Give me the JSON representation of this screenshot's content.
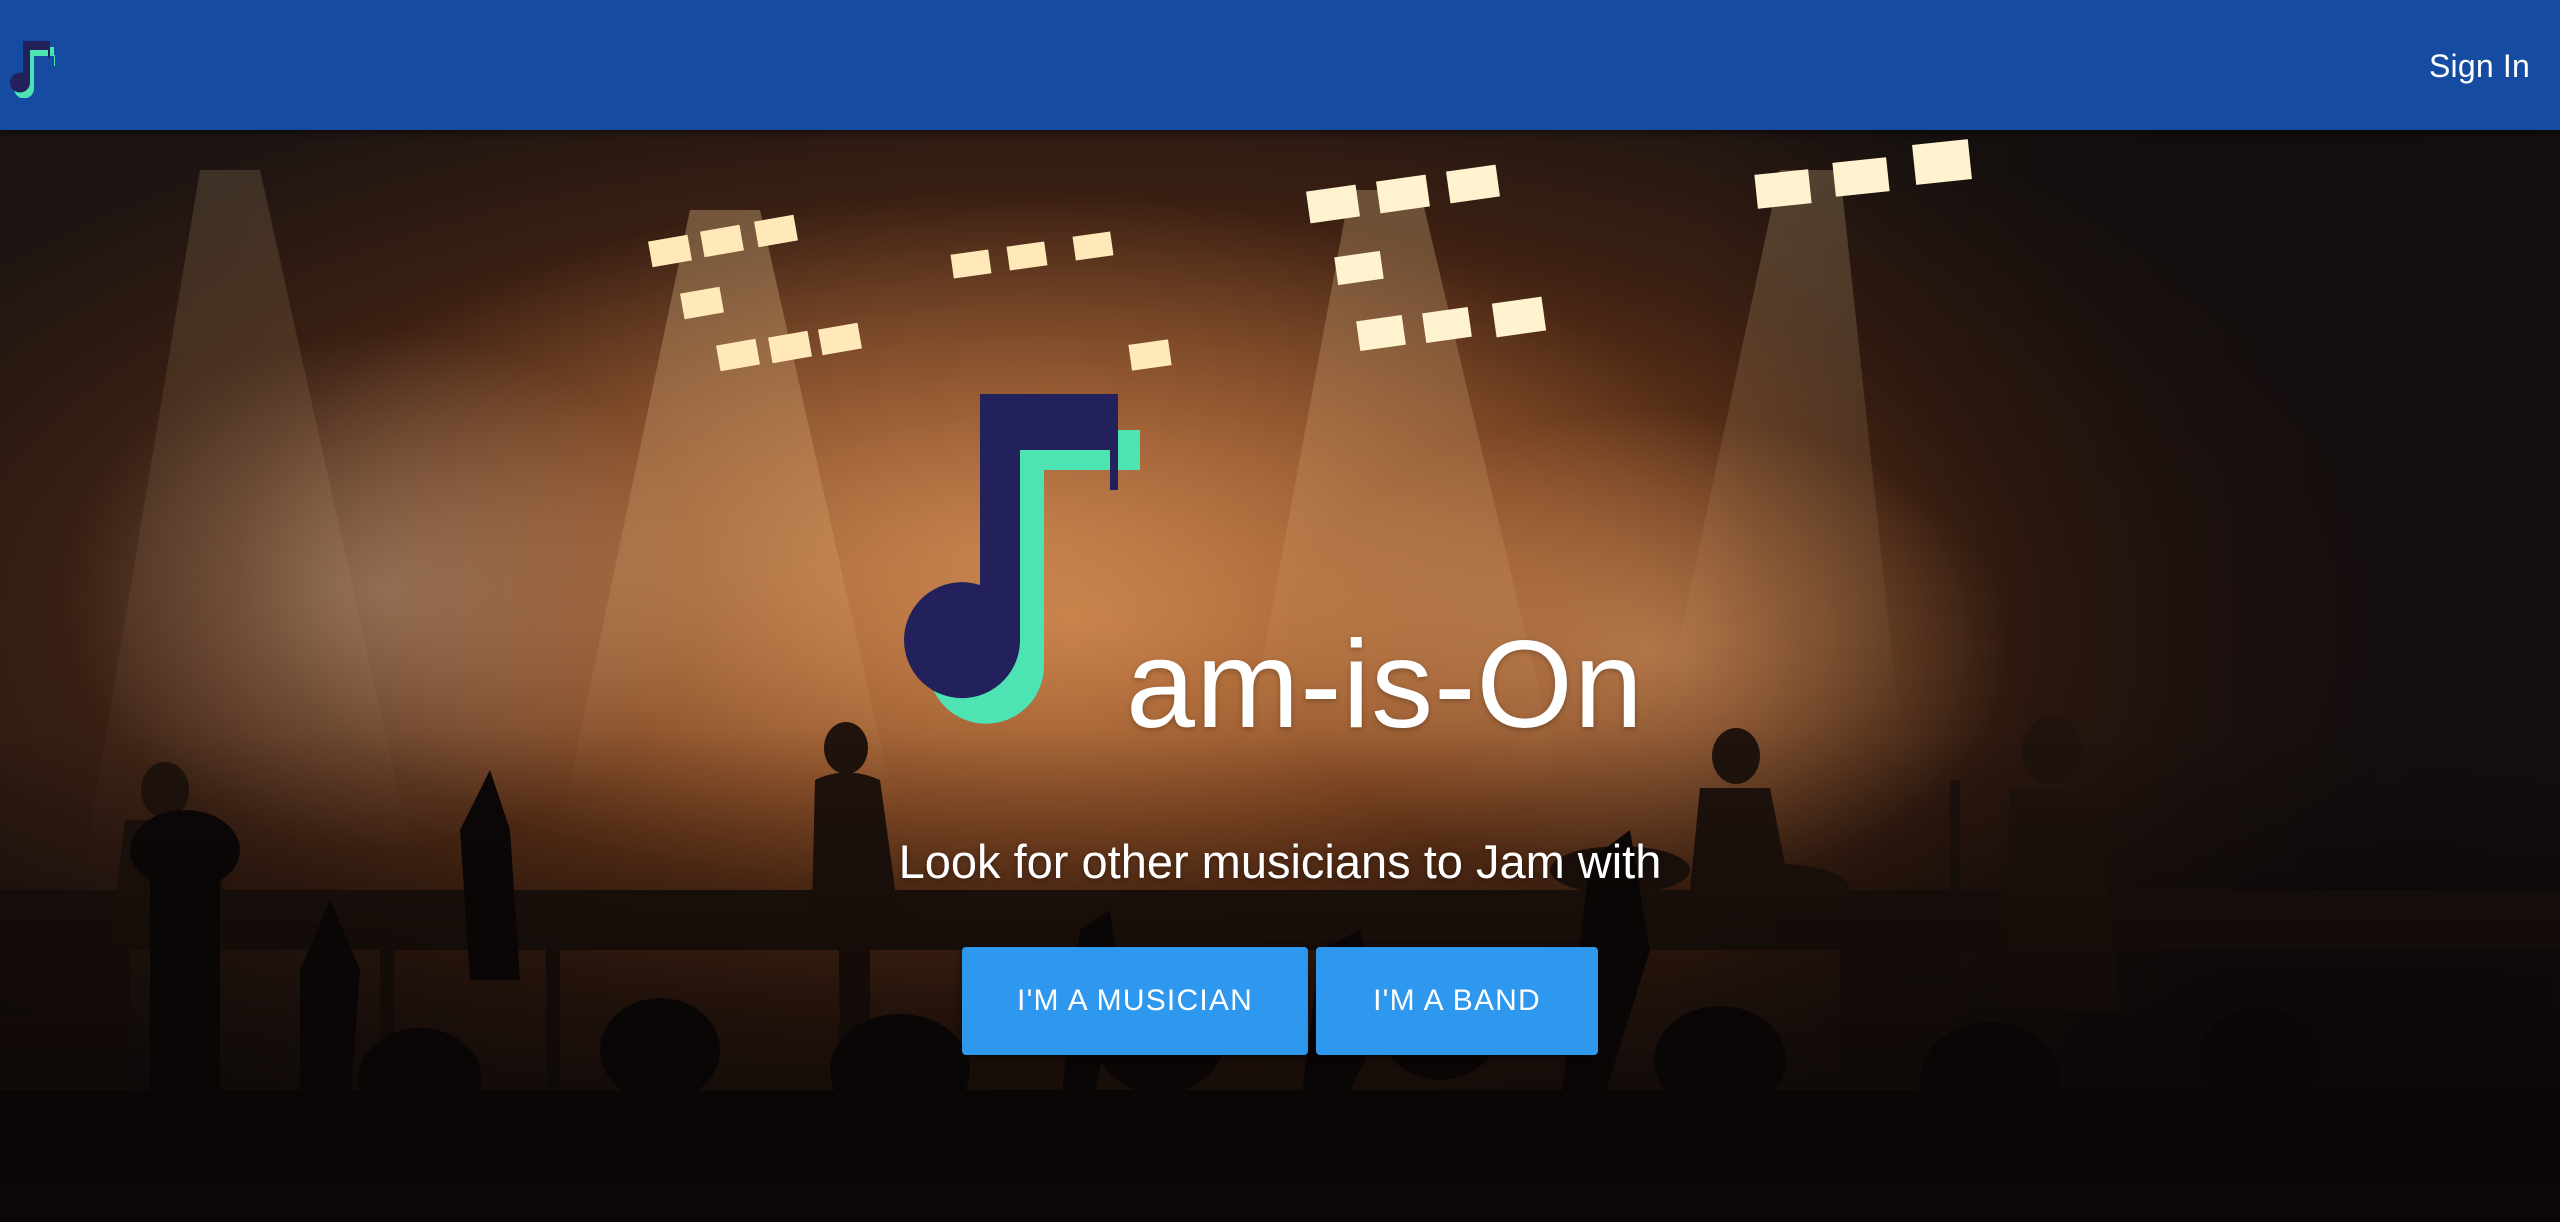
{
  "topbar": {
    "logo_icon": "music-note-logo-icon",
    "sign_in_label": "Sign In"
  },
  "hero": {
    "background": "concert-stage-photo",
    "logo_icon": "music-note-logo-icon",
    "title": "am-is-On",
    "tagline": "Look for other musicians to Jam with",
    "buttons": {
      "musician_label": "I'M A MUSICIAN",
      "band_label": "I'M A BAND"
    }
  },
  "colors": {
    "appbar": "#154ba0",
    "button": "#2d98ee",
    "logo_dark": "#22215c",
    "logo_accent": "#4de3b3"
  }
}
